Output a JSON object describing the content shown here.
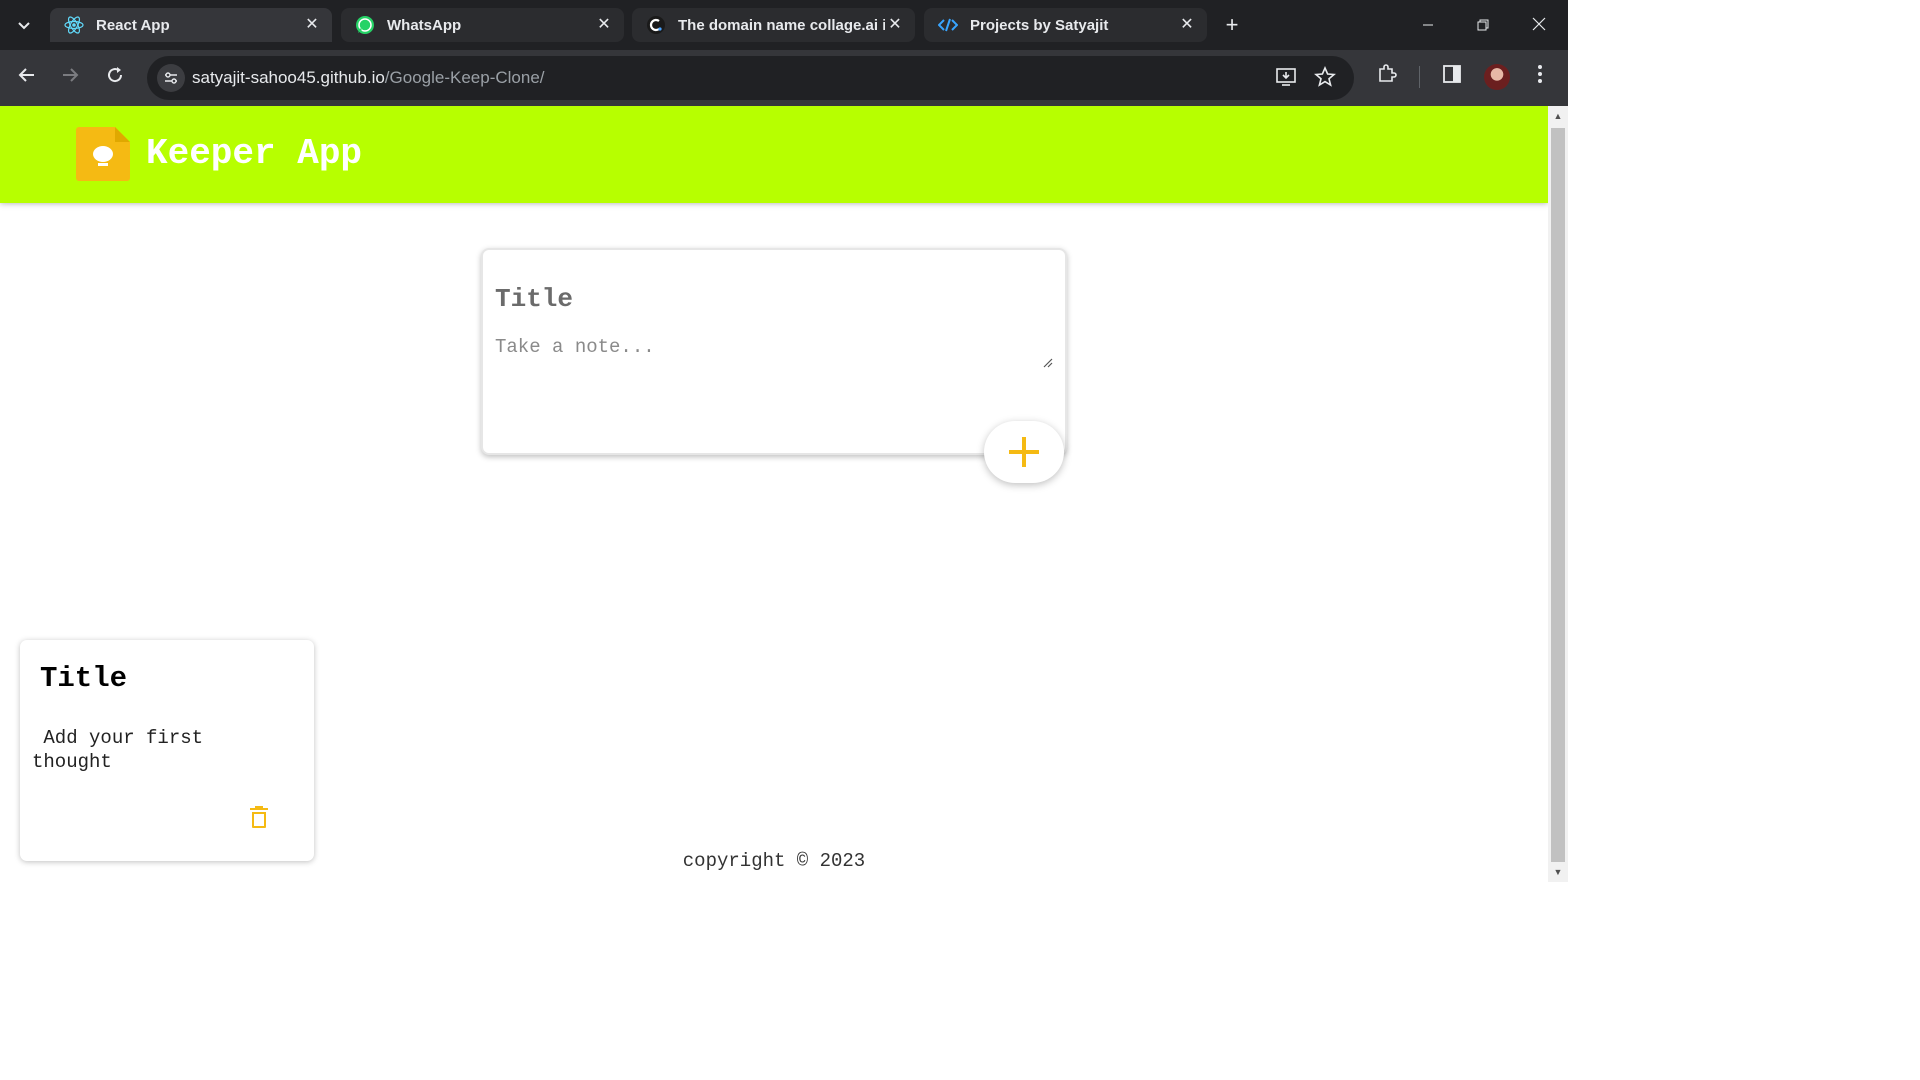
{
  "browser": {
    "tabs": [
      {
        "title": "React App",
        "icon": "react-icon",
        "active": true
      },
      {
        "title": "WhatsApp",
        "icon": "whatsapp-icon",
        "active": false
      },
      {
        "title": "The domain name collage.ai is",
        "icon": "collage-icon",
        "active": false
      },
      {
        "title": "Projects by Satyajit",
        "icon": "code-icon",
        "active": false
      }
    ],
    "url_host": "satyajit-sahoo45.github.io",
    "url_path": "/Google-Keep-Clone/"
  },
  "app": {
    "title": "Keeper App",
    "brand_color": "#b7ff00",
    "accent_color": "#f5ba13"
  },
  "create_area": {
    "title_placeholder": "Title",
    "note_placeholder": "Take a note...",
    "add_icon": "plus-icon"
  },
  "notes": [
    {
      "title": "Title",
      "content": " Add your first\nthought",
      "delete_icon": "trash-icon"
    }
  ],
  "footer": {
    "text": "copyright © 2023"
  }
}
